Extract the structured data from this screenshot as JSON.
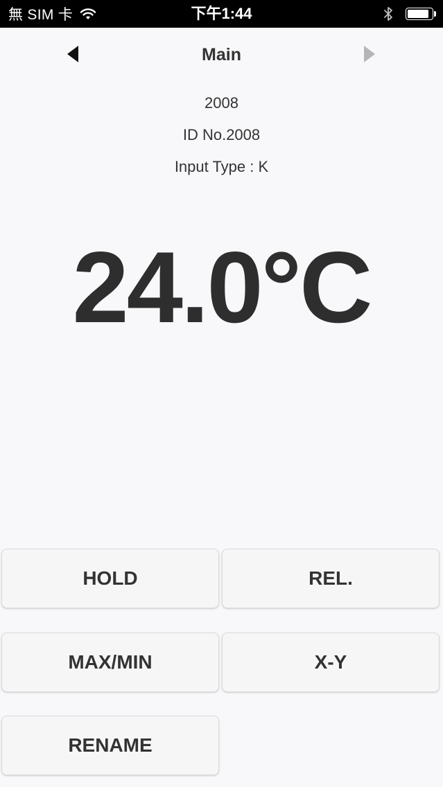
{
  "status_bar": {
    "carrier": "無 SIM 卡",
    "time": "下午1:44",
    "wifi_icon": "wifi-icon",
    "bluetooth_icon": "bluetooth-icon",
    "battery_icon": "battery-icon",
    "battery_level": 0.95
  },
  "nav": {
    "title": "Main",
    "prev_icon": "triangle-left-icon",
    "next_icon": "triangle-right-icon",
    "prev_enabled": true,
    "next_enabled": false,
    "colors": {
      "enabled": "#111111",
      "disabled": "#b5b5b5"
    }
  },
  "device": {
    "name": "2008",
    "id_line": "ID No.2008",
    "input_type_line": "Input Type : K"
  },
  "reading": {
    "value_text": "24.0°C"
  },
  "buttons": {
    "hold": "HOLD",
    "rel": "REL.",
    "max_min": "MAX/MIN",
    "x_y": "X-Y",
    "rename": "RENAME"
  },
  "colors": {
    "background": "#f8f8fa",
    "status_bar": "#000000",
    "text": "#333333",
    "button_bg": "#f6f6f6",
    "button_border": "#dcdcdc"
  }
}
